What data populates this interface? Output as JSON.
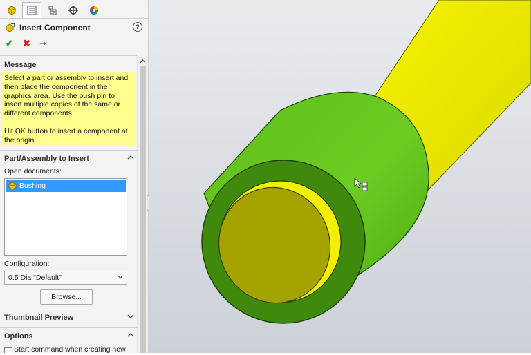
{
  "property_manager": {
    "tabs": [
      {
        "icon": "feature-manager-icon"
      },
      {
        "icon": "property-manager-icon"
      },
      {
        "icon": "configuration-manager-icon"
      },
      {
        "icon": "dimxpert-manager-icon"
      },
      {
        "icon": "display-manager-icon"
      }
    ],
    "title": "Insert Component",
    "help_label": "?",
    "actions": {
      "ok": "✔",
      "cancel": "✖",
      "pin": "⇥"
    }
  },
  "message": {
    "heading": "Message",
    "text1": "Select a part or assembly to insert and then place the component in the graphics area. Use the push pin to insert multiple copies of the same or different components.",
    "text2": "Hit OK button to insert a component at the origin."
  },
  "part_assembly": {
    "heading": "Part/Assembly to Insert",
    "open_docs_label": "Open documents:",
    "documents": [
      "Bushing"
    ],
    "configuration_label": "Configuration:",
    "configuration_value": "0.5 Dia \"Default\"",
    "browse_label": "Browse..."
  },
  "thumbnail": {
    "heading": "Thumbnail Preview"
  },
  "options": {
    "heading": "Options",
    "start_command_label": "Start command when creating new"
  },
  "colors": {
    "accent_green": "#5fbf1a",
    "shaft_yellow": "#f2f000",
    "message_bg": "#ffff8d",
    "selection": "#3399ff",
    "viewport_bg": "#dde1e6"
  }
}
